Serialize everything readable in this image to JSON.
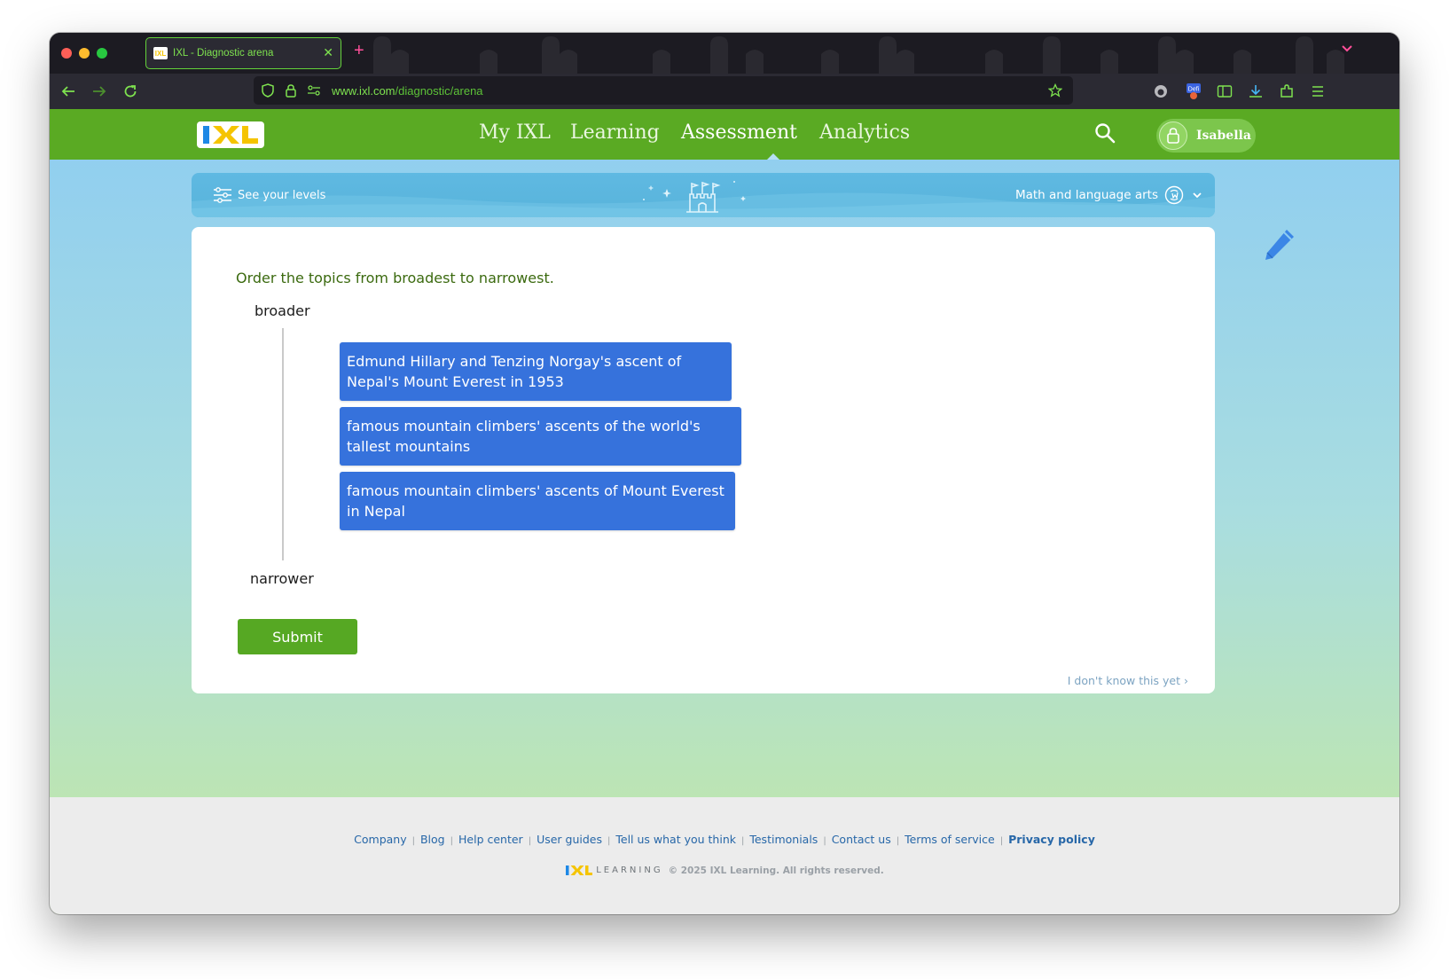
{
  "browser": {
    "tab_title": "IXL - Diagnostic arena",
    "tab_favicon_text": "IXL",
    "url_host": "www.ixl.com",
    "url_path": "/diagnostic/arena"
  },
  "header": {
    "logo_text": "IXL",
    "nav": [
      "My IXL",
      "Learning",
      "Assessment",
      "Analytics"
    ],
    "active_nav": "Assessment",
    "user_name": "Isabella"
  },
  "levels_bar": {
    "left_label": "See your levels",
    "subject": "Math and language arts"
  },
  "question": {
    "prompt": "Order the topics from broadest to narrowest.",
    "top_label": "broader",
    "bottom_label": "narrower",
    "tiles": [
      "Edmund Hillary and Tenzing Norgay's ascent of Nepal's Mount Everest in 1953",
      "famous mountain climbers' ascents of the world's tallest mountains",
      "famous mountain climbers' ascents of Mount Everest in Nepal"
    ],
    "submit_label": "Submit",
    "dont_know_label": "I don't know this yet"
  },
  "footer": {
    "links": [
      "Company",
      "Blog",
      "Help center",
      "User guides",
      "Tell us what you think",
      "Testimonials",
      "Contact us",
      "Terms of service",
      "Privacy policy"
    ],
    "brand_logo": "IXL",
    "brand_word": "LEARNING",
    "copyright": "© 2025 IXL Learning. All rights reserved."
  },
  "colors": {
    "header_green": "#5aaa23",
    "tile_blue": "#3672dc",
    "submit_green": "#56a823",
    "prompt_green": "#3b6a0f"
  }
}
